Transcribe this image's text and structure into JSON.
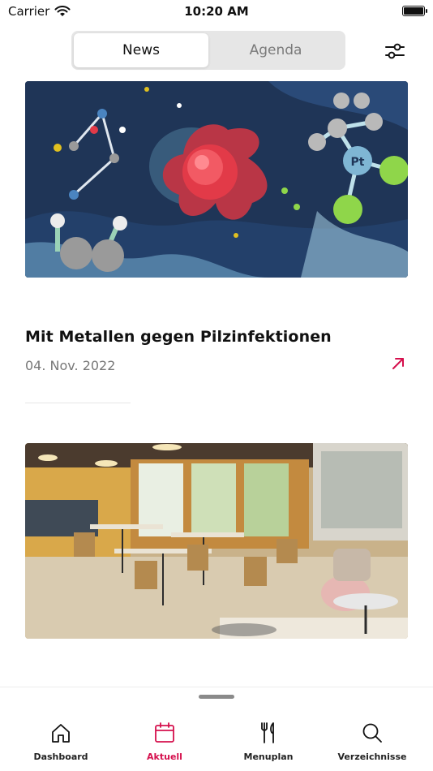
{
  "status_bar": {
    "carrier": "Carrier",
    "time": "10:20 AM"
  },
  "segmented": {
    "tabs": [
      {
        "label": "News",
        "active": true
      },
      {
        "label": "Agenda",
        "active": false
      }
    ]
  },
  "articles": [
    {
      "title": "Mit Metallen gegen Pilzinfektionen",
      "date": "04. Nov. 2022",
      "image_label": "Pt"
    }
  ],
  "tabbar": {
    "items": [
      {
        "label": "Dashboard",
        "icon": "home-icon",
        "active": false
      },
      {
        "label": "Aktuell",
        "icon": "calendar-icon",
        "active": true
      },
      {
        "label": "Menuplan",
        "icon": "fork-knife-icon",
        "active": false
      },
      {
        "label": "Verzeichnisse",
        "icon": "search-icon",
        "active": false
      }
    ]
  },
  "colors": {
    "accent": "#d5104d",
    "segment_bg": "#e6e6e6"
  }
}
